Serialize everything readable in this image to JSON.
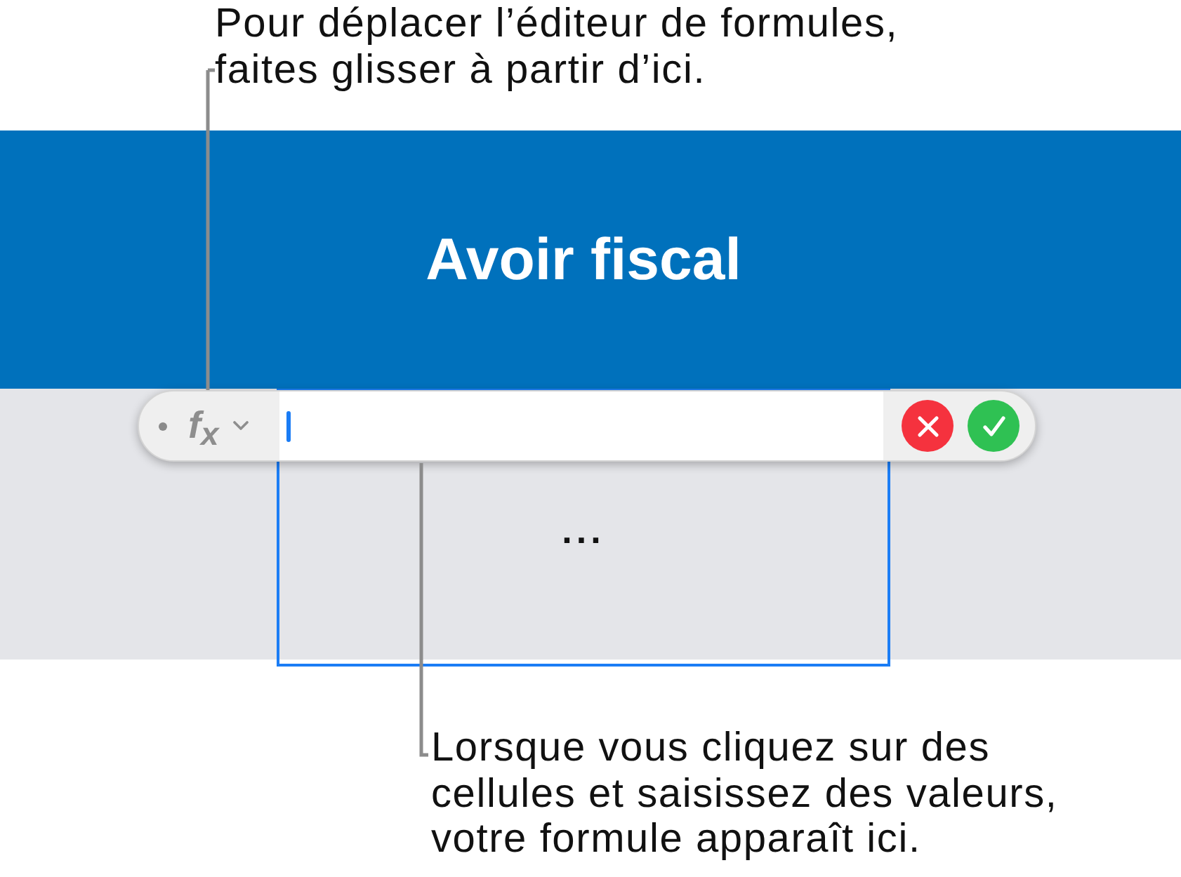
{
  "top_callout": {
    "lines": [
      "Pour déplacer l’éditeur de formules,",
      "faites glisser à partir d’ici."
    ]
  },
  "table": {
    "title": "Avoir fiscal",
    "cell": {
      "value": "...",
      "selected": true
    }
  },
  "formula_editor": {
    "function_label": "f$_{x}$",
    "focused": true
  },
  "bottom_callout": {
    "lines": [
      "Lorsque vous cliquez sur des",
      "cellules et saisissez des valeurs,",
      "votre formule apparaît ici."
    ]
  }
}
